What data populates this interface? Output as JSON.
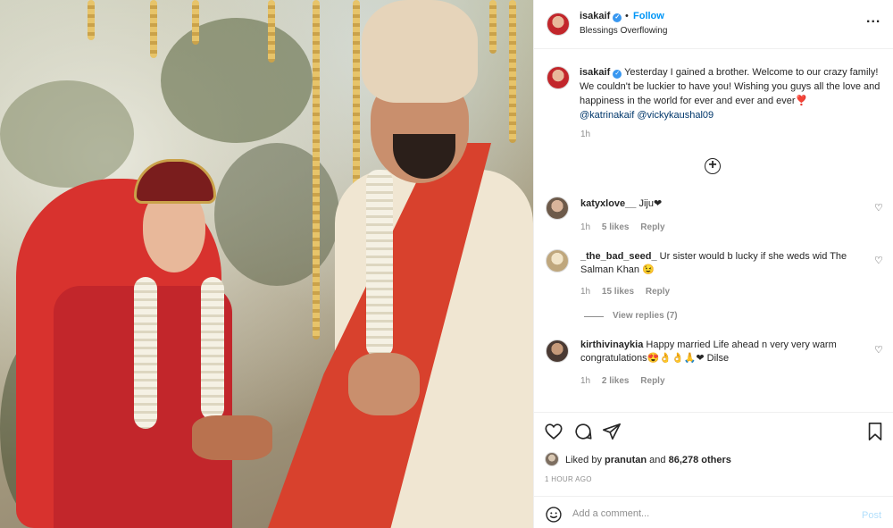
{
  "header": {
    "username": "isakaif",
    "follow_label": "Follow",
    "subtitle": "Blessings Overflowing",
    "dot": "•",
    "more_label": "..."
  },
  "caption": {
    "username": "isakaif",
    "text": "Yesterday I gained a brother. Welcome to our crazy family! We couldn't be luckier to have you! Wishing you guys all the love and happiness in the world for ever and ever and ever❣️",
    "mention1": "@katrinakaif",
    "mention2": "@vickykaushal09",
    "time": "1h"
  },
  "comments": [
    {
      "username": "katyxlove__",
      "text": "Jiju❤",
      "time": "1h",
      "likes": "5 likes",
      "reply": "Reply"
    },
    {
      "username": "_the_bad_seed_",
      "text": "Ur sister would b lucky if she weds wid The Salman Khan 😉",
      "time": "1h",
      "likes": "15 likes",
      "reply": "Reply",
      "view_replies": "View replies (7)"
    },
    {
      "username": "kirthivinaykia",
      "text": "Happy married Life ahead n very very warm congratulations😍👌👌🙏❤ Dilse",
      "time": "1h",
      "likes": "2 likes",
      "reply": "Reply"
    }
  ],
  "likes": {
    "prefix": "Liked by",
    "user": "pranutan",
    "and": "and",
    "count": "86,278 others"
  },
  "time_ago": "1 HOUR AGO",
  "add_comment": {
    "placeholder": "Add a comment...",
    "post_label": "Post"
  },
  "icons": {
    "verified": "verified-badge-icon",
    "heart": "heart-icon",
    "comment": "comment-icon",
    "share": "share-icon",
    "save": "bookmark-icon",
    "emoji": "emoji-icon",
    "load_more": "plus-circle-icon"
  },
  "colors": {
    "link": "#0095f6",
    "mention": "#00376b",
    "muted": "#8e8e8e",
    "post_disabled": "#b2dffc"
  }
}
